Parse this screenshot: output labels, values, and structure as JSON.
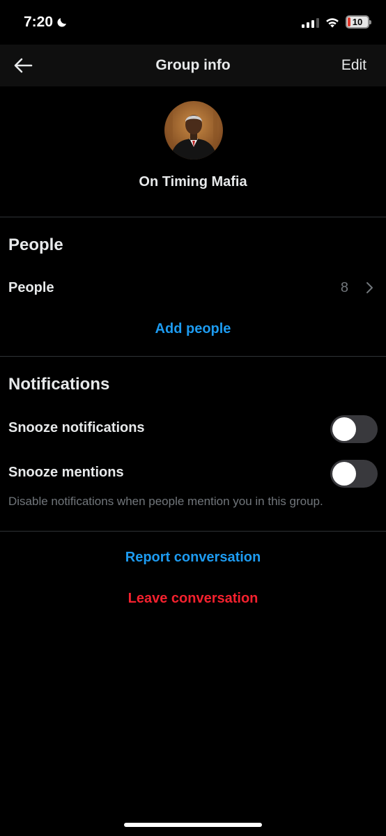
{
  "status_bar": {
    "time": "7:20",
    "battery_level": "10",
    "icons": [
      "moon-icon",
      "cellular-signal-icon",
      "wifi-icon",
      "battery-icon"
    ]
  },
  "nav": {
    "title": "Group info",
    "edit_label": "Edit",
    "back_icon": "arrow-left-icon"
  },
  "group": {
    "name": "On Timing Mafia",
    "avatar_icon": "group-avatar-photo"
  },
  "people_section": {
    "heading": "People",
    "row_label": "People",
    "count": "8",
    "add_label": "Add people"
  },
  "notifications_section": {
    "heading": "Notifications",
    "snooze_notifications_label": "Snooze notifications",
    "snooze_notifications_on": false,
    "snooze_mentions_label": "Snooze mentions",
    "snooze_mentions_on": false,
    "mentions_helper": "Disable notifications when people mention you in this group."
  },
  "actions": {
    "report_label": "Report conversation",
    "leave_label": "Leave conversation"
  },
  "colors": {
    "background": "#000000",
    "link_blue": "#1d9bf0",
    "destructive_red": "#f4212e",
    "secondary_text": "#71767b"
  }
}
